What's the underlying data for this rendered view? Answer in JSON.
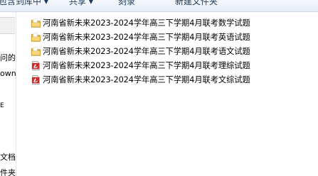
{
  "toolbar": {
    "items": [
      {
        "label": "包含到库中 ▾"
      },
      {
        "label": "共享 ▾"
      },
      {
        "label": "刻录"
      },
      {
        "label": "新建文件夹"
      }
    ]
  },
  "navigation_pane": {
    "items": [
      {
        "label": "问的"
      },
      {
        "label": "own"
      },
      {
        "label": "E"
      },
      {
        "label": "文档"
      },
      {
        "label": "件夹"
      }
    ]
  },
  "files": [
    {
      "name": "河南省新未来2023-2024学年高三下学期4月联考数学试题",
      "type": "folder",
      "icon": "folder-icon"
    },
    {
      "name": "河南省新未来2023-2024学年高三下学期4月联考英语试题",
      "type": "folder",
      "icon": "folder-icon"
    },
    {
      "name": "河南省新未来2023-2024学年高三下学期4月联考语文试题",
      "type": "folder",
      "icon": "folder-icon"
    },
    {
      "name": "河南省新未来2023-2024学年高三下学期4月联考理综试题",
      "type": "pdf",
      "icon": "pdf-file-icon"
    },
    {
      "name": "河南省新未来2023-2024学年高三下学期4月联考文综试题",
      "type": "pdf",
      "icon": "pdf-file-icon"
    }
  ],
  "colors": {
    "folder": "#e8b84a",
    "pdf_red": "#cc2a2a",
    "toolbar_text": "#1e395b"
  }
}
